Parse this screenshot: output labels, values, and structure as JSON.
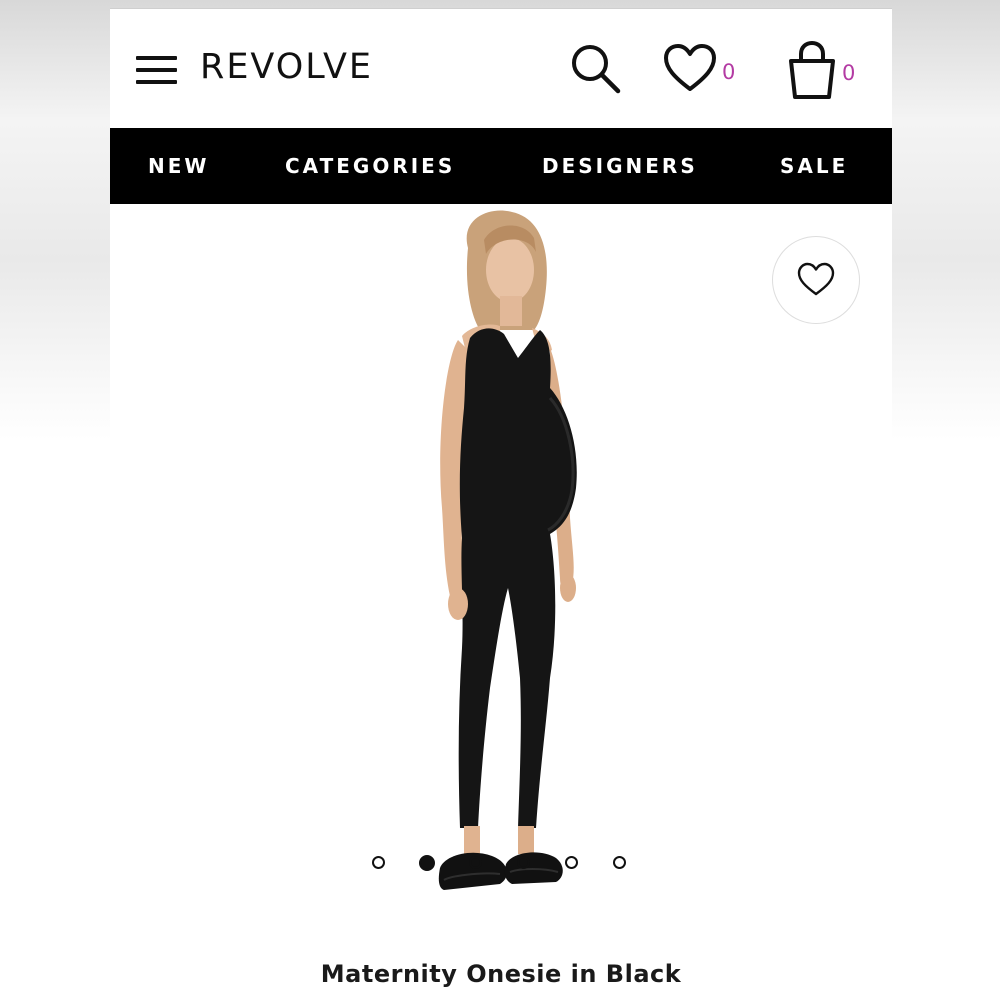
{
  "header": {
    "logo": "REVOLVE",
    "wishlist_count": "0",
    "bag_count": "0",
    "icons": [
      "hamburger-menu-icon",
      "search-icon",
      "heart-icon",
      "shopping-bag-icon"
    ]
  },
  "nav": {
    "items": [
      {
        "label": "NEW"
      },
      {
        "label": "CATEGORIES"
      },
      {
        "label": "DESIGNERS"
      },
      {
        "label": "SALE"
      }
    ]
  },
  "product": {
    "title": "Maternity Onesie in Black",
    "image_count": 6,
    "active_image": 2
  },
  "colors": {
    "nav_background": "#000000",
    "count_accent": "#b33aa3",
    "text": "#111111"
  }
}
